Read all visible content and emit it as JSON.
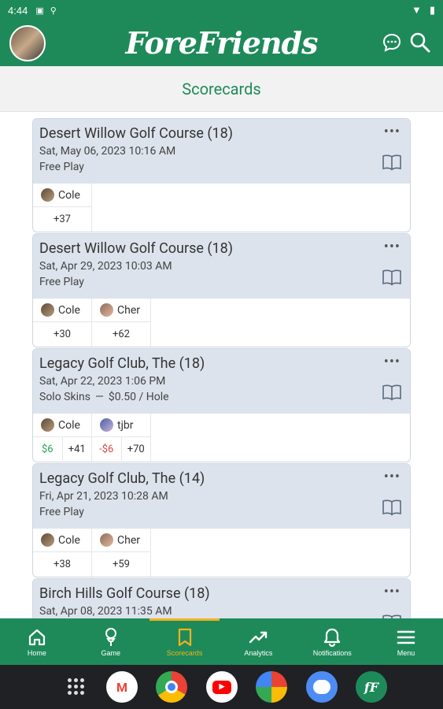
{
  "status_bar": {
    "time": "4:44"
  },
  "header": {
    "logo": "ForeFriends"
  },
  "page": {
    "title": "Scorecards"
  },
  "cards": [
    {
      "course": "Desert Willow Golf Course (18)",
      "date": "Sat, May 06, 2023 10:16 AM",
      "mode": "Free Play",
      "stake": "",
      "players": [
        {
          "name": "Cole",
          "score": "+37",
          "money": ""
        }
      ]
    },
    {
      "course": "Desert Willow Golf Course (18)",
      "date": "Sat, Apr 29, 2023 10:03 AM",
      "mode": "Free Play",
      "stake": "",
      "players": [
        {
          "name": "Cole",
          "score": "+30",
          "money": ""
        },
        {
          "name": "Cher",
          "score": "+62",
          "money": ""
        }
      ]
    },
    {
      "course": "Legacy Golf Club, The (18)",
      "date": "Sat, Apr 22, 2023 1:06 PM",
      "mode": "Solo Skins",
      "stake": "$0.50 / Hole",
      "players": [
        {
          "name": "Cole",
          "score": "+41",
          "money": "$6"
        },
        {
          "name": "tjbr",
          "score": "+70",
          "money": "-$6"
        }
      ]
    },
    {
      "course": "Legacy Golf Club, The (14)",
      "date": "Fri, Apr 21, 2023 10:28 AM",
      "mode": "Free Play",
      "stake": "",
      "players": [
        {
          "name": "Cole",
          "score": "+38",
          "money": ""
        },
        {
          "name": "Cher",
          "score": "+59",
          "money": ""
        }
      ]
    },
    {
      "course": "Birch Hills Golf Course (18)",
      "date": "Sat, Apr 08, 2023 11:35 AM",
      "mode": "",
      "stake": "",
      "players": []
    }
  ],
  "nav": [
    {
      "label": "Home",
      "icon": "home-icon"
    },
    {
      "label": "Game",
      "icon": "golf-tee-icon"
    },
    {
      "label": "Scorecards",
      "icon": "bookmark-icon",
      "active": true
    },
    {
      "label": "Analytics",
      "icon": "trending-icon"
    },
    {
      "label": "Notifications",
      "icon": "bell-icon"
    },
    {
      "label": "Menu",
      "icon": "hamburger-icon"
    }
  ],
  "colors": {
    "brand": "#1e8a5a",
    "accent": "#f2b11c",
    "card_header": "#dde3ec",
    "win": "#2aa452",
    "loss": "#d44444"
  }
}
